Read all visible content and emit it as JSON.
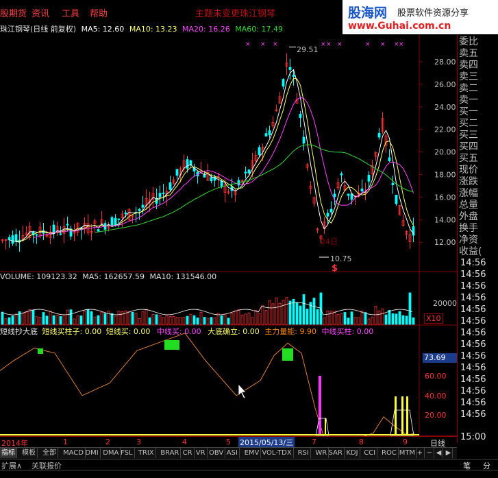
{
  "menu": {
    "items": [
      "股期货",
      "资讯",
      "工具",
      "帮助"
    ],
    "center_title_1": "主题未变更",
    "center_title_2": "珠江钢琴"
  },
  "banner": {
    "logo": "股海网",
    "tagline": "股票软件资源分享",
    "url": "www.Guhai.com.cn"
  },
  "info": {
    "stock": "珠江钢琴(日线 前复权)",
    "ma5": "MA5: 12.60",
    "ma10": "MA10: 13.23",
    "ma20": "MA20: 16.26",
    "ma60": "MA60: 17.49"
  },
  "colors": {
    "ma5": "#ffffff",
    "ma10": "#ffff66",
    "ma20": "#ff44ff",
    "ma60": "#33dd33",
    "up": "#ff3333",
    "down": "#00ffff",
    "grid": "#8b0000",
    "axis_label": "#ff3333"
  },
  "price_chart": {
    "ticks": [
      "28.00",
      "26.00",
      "24.00",
      "22.00",
      "20.00",
      "18.00",
      "16.00",
      "14.00",
      "12.00"
    ],
    "high_label": "29.51",
    "low_label": "10.75",
    "marker": "$",
    "note": "24日"
  },
  "volume": {
    "header_volume": "VOLUME: 109123.32",
    "header_ma5": "MA5: 162657.59",
    "header_ma10": "MA10: 131546.00",
    "tick": "20000",
    "unit": "X10"
  },
  "indicator": {
    "name": "短线抄大底",
    "labels": [
      "短线买柱子: 0.00",
      "短线买: 0.00",
      "中线买: 0.00",
      "大底确立: 0.00",
      "主力量能: 9.90",
      "中线买柱: 0.00"
    ],
    "current": "73.69",
    "ticks": [
      "60.00",
      "40.00",
      "20.00"
    ]
  },
  "time_axis": {
    "labels": [
      "2014年",
      "1",
      "2",
      "3",
      "4",
      "5",
      "7",
      "8",
      "9"
    ],
    "selected_date": "2015/05/13/三",
    "period": "日线"
  },
  "right_panel": {
    "quote_labels": [
      "委比",
      "卖五",
      "卖四",
      "卖三",
      "卖二",
      "卖一",
      "买一",
      "买二",
      "买三",
      "买四",
      "买五",
      "现价",
      "涨跌",
      "涨幅",
      "总量",
      "外盘",
      "换手",
      "净资",
      "收益(",
      "14:56",
      "14:56",
      "14:56",
      "14:56",
      "14:56",
      "14:56",
      "14:56",
      "14:56",
      "14:56",
      "14:56",
      "14:56",
      "14:56",
      "14:56",
      "14:56",
      "15:00"
    ]
  },
  "tabs": [
    "指标",
    "模板",
    "全部",
    "MACD",
    "DMI",
    "DMA",
    "FSL",
    "TRIX",
    "BRAR",
    "CR",
    "VR",
    "OBV",
    "ASI",
    "EMV",
    "VOL-TDX",
    "RSI",
    "WR",
    "SAR",
    "KDJ",
    "CCI",
    "ROC",
    "MTM",
    "+",
    "−",
    "◀",
    "▶"
  ],
  "bottom": {
    "expand": "扩展∧",
    "related": "关联报价",
    "status": "笔",
    "time": "分"
  }
}
